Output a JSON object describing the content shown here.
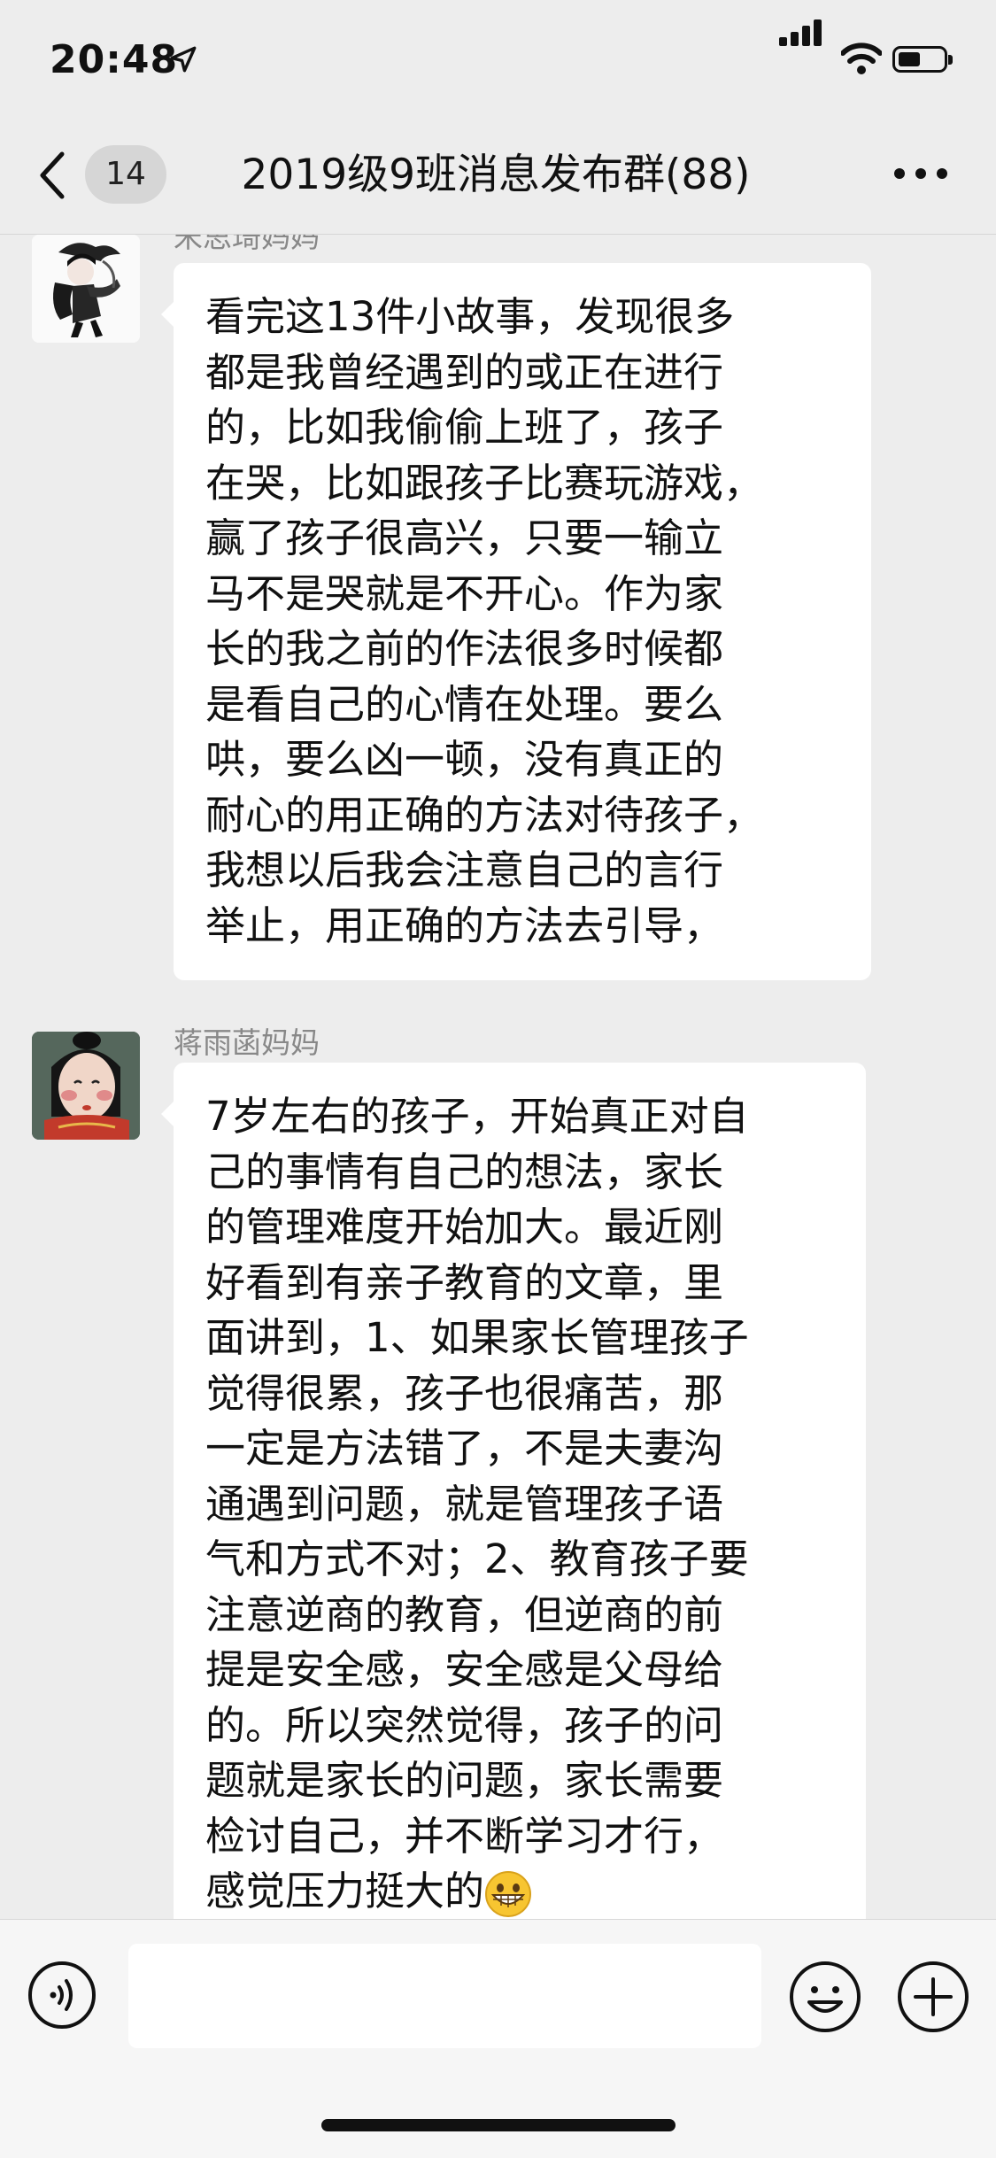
{
  "status_bar": {
    "time": "20:48"
  },
  "nav": {
    "unread_count": "14",
    "title": "2019级9班消息发布群(88)"
  },
  "messages": [
    {
      "sender": "宋思琦妈妈",
      "lines": [
        "看完这13件小故事，发现很多",
        "都是我曾经遇到的或正在进行",
        "的，比如我偷偷上班了，孩子",
        "在哭，比如跟孩子比赛玩游戏，",
        "赢了孩子很高兴，只要一输立",
        "马不是哭就是不开心。作为家",
        "长的我之前的作法很多时候都",
        "是看自己的心情在处理。要么",
        "哄，要么凶一顿，没有真正的",
        "耐心的用正确的方法对待孩子，",
        "我想以后我会注意自己的言行",
        "举止，用正确的方法去引导，"
      ]
    },
    {
      "sender": "蒋雨菡妈妈",
      "lines": [
        "7岁左右的孩子，开始真正对自",
        "己的事情有自己的想法，家长",
        "的管理难度开始加大。最近刚",
        "好看到有亲子教育的文章，里",
        "面讲到，1、如果家长管理孩子",
        "觉得很累，孩子也很痛苦，那",
        "一定是方法错了，不是夫妻沟",
        "通遇到问题，就是管理孩子语",
        "气和方式不对；2、教育孩子要",
        "注意逆商的教育，但逆商的前",
        "提是安全感，安全感是父母给",
        "的。所以突然觉得，孩子的问",
        "题就是家长的问题，家长需要",
        "检讨自己，并不断学习才行，",
        "感觉压力挺大的"
      ]
    }
  ],
  "colors": {
    "background": "#ededed",
    "bubble": "#ffffff",
    "sender_name": "#888888",
    "input_bar": "#f6f6f6"
  },
  "icons": {
    "back": "chevron-left-icon",
    "more": "more-dots-icon",
    "voice": "voice-input-icon",
    "emoji": "emoji-icon",
    "plus": "plus-icon",
    "message_emoji": "grinning-face-emoji"
  }
}
